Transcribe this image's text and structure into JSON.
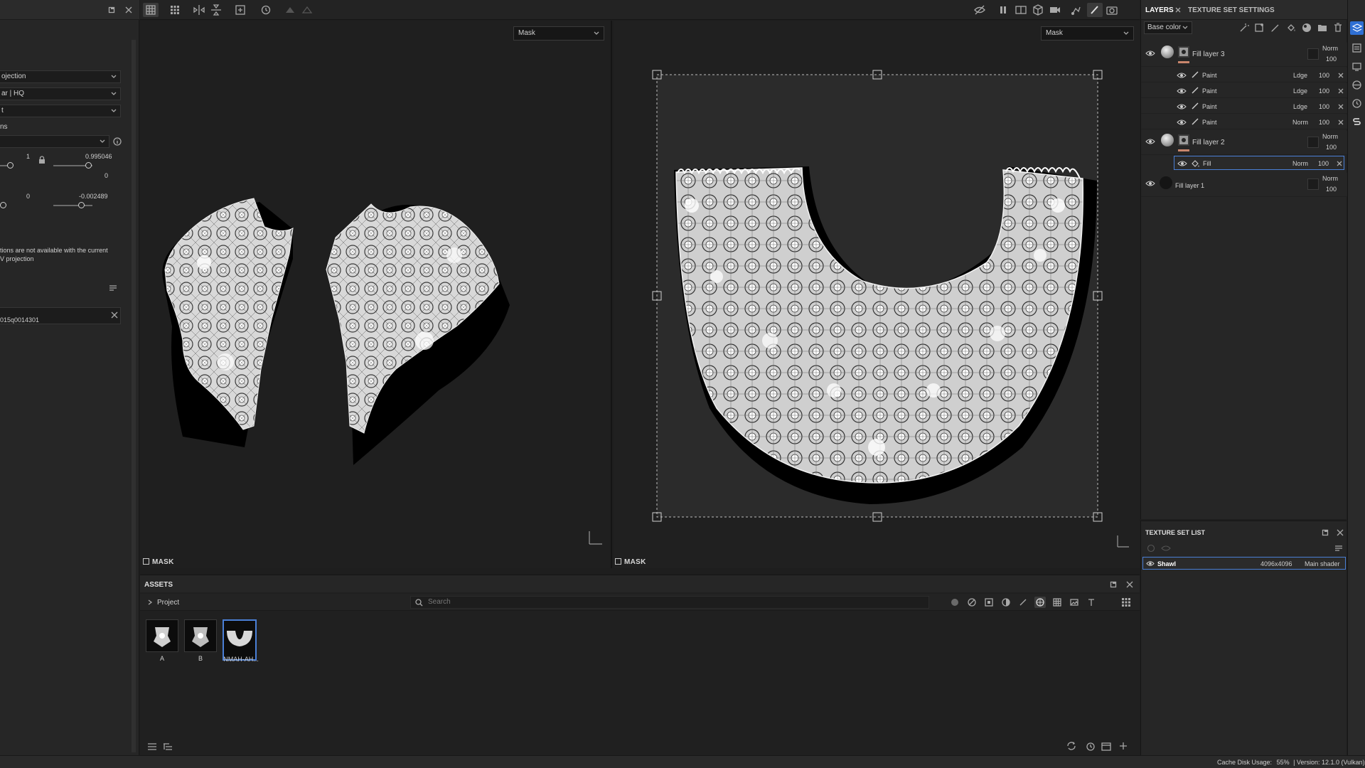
{
  "left_panel": {
    "selects": [
      "ojection",
      "ar | HQ",
      "t"
    ],
    "section": "ns",
    "row1": {
      "left": "1",
      "right": "0.995046",
      "below": "0"
    },
    "row2": {
      "left": "0",
      "right": "-0.002489"
    },
    "note_line1": "tions are not available with the current",
    "note_line2": "V projection",
    "resource": "015q0014301"
  },
  "viewport_left": {
    "dropdown": "Mask",
    "label": "MASK"
  },
  "viewport_right": {
    "dropdown": "Mask",
    "label": "MASK"
  },
  "assets": {
    "title": "ASSETS",
    "tree_item": "Project",
    "search_placeholder": "Search",
    "items": [
      {
        "label": "A"
      },
      {
        "label": "B"
      },
      {
        "label": "NMAH-AH..."
      }
    ]
  },
  "layers": {
    "tabs": [
      "LAYERS",
      "TEXTURE SET SETTINGS"
    ],
    "channel": "Base color",
    "rows": [
      {
        "name": "Fill layer 3",
        "blend": "Norm",
        "opacity": "100"
      },
      {
        "name": "Paint",
        "blend": "Ldge",
        "opacity": "100"
      },
      {
        "name": "Paint",
        "blend": "Ldge",
        "opacity": "100"
      },
      {
        "name": "Paint",
        "blend": "Ldge",
        "opacity": "100"
      },
      {
        "name": "Paint",
        "blend": "Norm",
        "opacity": "100"
      },
      {
        "name": "Fill layer 2",
        "blend": "Norm",
        "opacity": "100"
      },
      {
        "name": "Fill",
        "blend": "Norm",
        "opacity": "100"
      },
      {
        "name": "Fill layer 1",
        "blend": "Norm",
        "opacity": "100"
      }
    ]
  },
  "texture_set_list": {
    "title": "TEXTURE SET LIST",
    "item": {
      "name": "Shawl",
      "resolution": "4096x4096",
      "shader": "Main shader"
    }
  },
  "statusbar": {
    "cache_label": "Cache Disk Usage:",
    "cache_value": "55%",
    "version": "| Version: 12.1.0 (Vulkan)"
  },
  "colors": {
    "accent": "#4a7fd6",
    "panel": "#262626",
    "viewport": "#1f1f1f"
  }
}
